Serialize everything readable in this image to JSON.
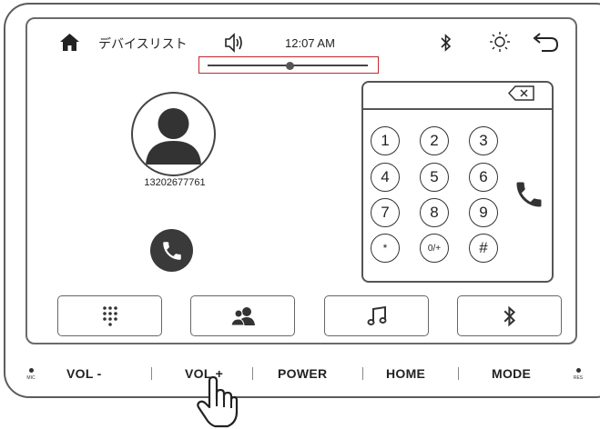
{
  "status_bar": {
    "title": "デバイスリスト",
    "time": "12:07 AM"
  },
  "volume": {
    "level": 0.52
  },
  "contact": {
    "phone_number": "13202677761"
  },
  "dialpad": {
    "keys": [
      "1",
      "2",
      "3",
      "4",
      "5",
      "6",
      "7",
      "8",
      "9",
      "*",
      "0/+",
      "#"
    ]
  },
  "bottom_tabs": [
    "dialpad-grid",
    "contacts",
    "music",
    "bluetooth"
  ],
  "hardware_buttons": {
    "vol_minus": "VOL -",
    "vol_plus": "VOL +",
    "power": "POWER",
    "home": "HOME",
    "mode": "MODE",
    "mic": "MIC",
    "res": "RES"
  },
  "colors": {
    "highlight_box": "#c0282d",
    "icon": "#333333"
  },
  "icons": [
    "home-icon",
    "speaker-icon",
    "bluetooth-icon",
    "brightness-icon",
    "back-arrow-icon",
    "backspace-icon",
    "phone-icon",
    "keypad-icon",
    "contacts-icon",
    "music-note-icon",
    "pointing-hand-icon"
  ]
}
